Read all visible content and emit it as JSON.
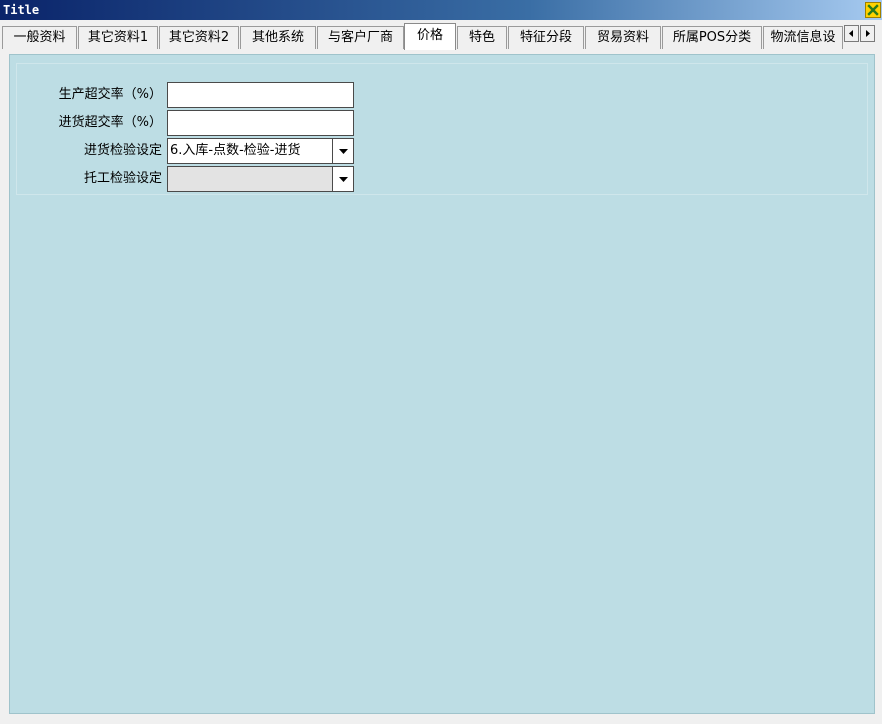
{
  "window": {
    "title": "Title"
  },
  "tabs": [
    {
      "label": "一般资料"
    },
    {
      "label": "其它资料1"
    },
    {
      "label": "其它资料2"
    },
    {
      "label": "其他系统"
    },
    {
      "label": "与客户厂商"
    },
    {
      "label": "价格"
    },
    {
      "label": "特色"
    },
    {
      "label": "特征分段"
    },
    {
      "label": "贸易资料"
    },
    {
      "label": "所属POS分类"
    },
    {
      "label": "物流信息设"
    }
  ],
  "active_tab": "价格",
  "form": {
    "production_over_rate": {
      "label": "生产超交率（%）",
      "value": ""
    },
    "purchase_over_rate": {
      "label": "进货超交率（%）",
      "value": ""
    },
    "purchase_inspection": {
      "label": "进货检验设定",
      "value": "6.入库-点数-检验-进货"
    },
    "outsource_inspection": {
      "label": "托工检验设定",
      "value": ""
    }
  },
  "icons": {
    "close": "close-icon",
    "scroll_left": "arrow-left-icon",
    "scroll_right": "arrow-right-icon",
    "dropdown": "chevron-down-icon"
  },
  "colors": {
    "titlebar": "#0a246a",
    "content_bg": "#bddde4",
    "close_button": "#ffd200"
  }
}
